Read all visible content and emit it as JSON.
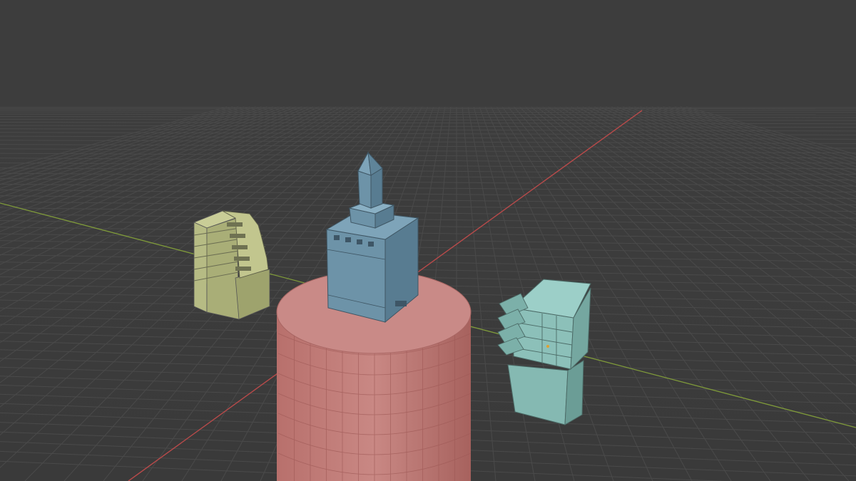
{
  "viewport": {
    "background_color": "#3d3d3d",
    "grid_line_color": "#4a4a4a",
    "x_axis_color": "#b84a4a",
    "y_axis_color": "#7f9a3a"
  },
  "objects": [
    {
      "name": "cylinder",
      "color": "#c7807c"
    },
    {
      "name": "tower-central",
      "color": "#6a8ea3"
    },
    {
      "name": "building-left",
      "color": "#b8bd86"
    },
    {
      "name": "building-right",
      "color": "#7fb3ac"
    }
  ]
}
